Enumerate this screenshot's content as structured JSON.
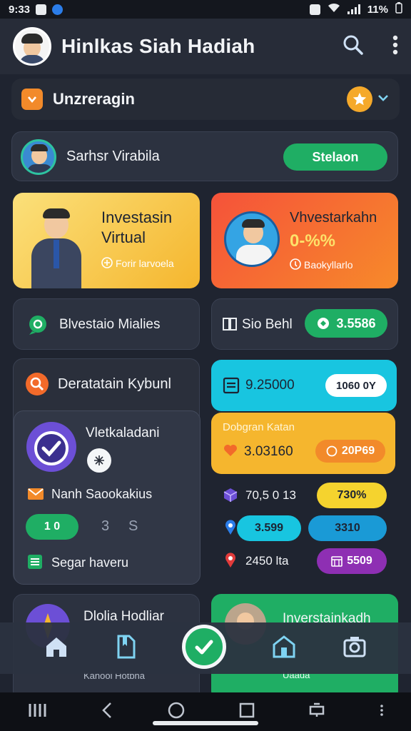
{
  "status": {
    "time": "9:33",
    "battery": "11%"
  },
  "appbar": {
    "title": "Hinlkas Siah Hadiah"
  },
  "section_header": {
    "label": "Unzreragin"
  },
  "profile_row": {
    "name": "Sarhsr Virabila",
    "button": "Stelaon"
  },
  "promo_yellow": {
    "title_line1": "Investasin",
    "title_line2": "Virtual",
    "sub": "Forir larvoela"
  },
  "promo_orange": {
    "title": "Vhvestarkahn",
    "rate": "0-%%",
    "sub": "Baokyllarlo"
  },
  "row_left": {
    "label": "Blvestaio Mialies"
  },
  "row_right": {
    "label": "Sio Behl",
    "pill": "3.5586"
  },
  "panel": {
    "title": "Deratatain Kybunl",
    "sub_title": "Vletkaladani",
    "sub_item": "Nanh Saookakius",
    "counter_pill": "1 0",
    "counter_a": "3",
    "counter_b": "S",
    "footer": "Segar haveru"
  },
  "cyan_card": {
    "value": "9.25000",
    "pill": "1060 0Y"
  },
  "gold_card": {
    "title": "Dobgran Katan",
    "value": "3.03160",
    "pill": "20P69"
  },
  "stats": [
    {
      "label": "70,5 0 13",
      "pill": "730%"
    },
    {
      "label": "3.599",
      "pill": "3310"
    },
    {
      "label": "2450 lta",
      "pill": "5509"
    }
  ],
  "bottom_left": {
    "title": "Dlolia Hodliar",
    "sub": "Kanooi Hotbha"
  },
  "bottom_right": {
    "title": "Inverstainkadh",
    "sub": "Uaada"
  },
  "colors": {
    "green": "#1fae64",
    "orange": "#f26a2a",
    "gold": "#f5b62e",
    "cyan": "#18c5e0",
    "purple": "#8e2fb3"
  },
  "icons": [
    "search-icon",
    "more-vert-icon",
    "star-icon",
    "chevron-down-icon",
    "check-icon",
    "home-icon",
    "bookmark-icon",
    "shop-icon",
    "camera-icon"
  ]
}
